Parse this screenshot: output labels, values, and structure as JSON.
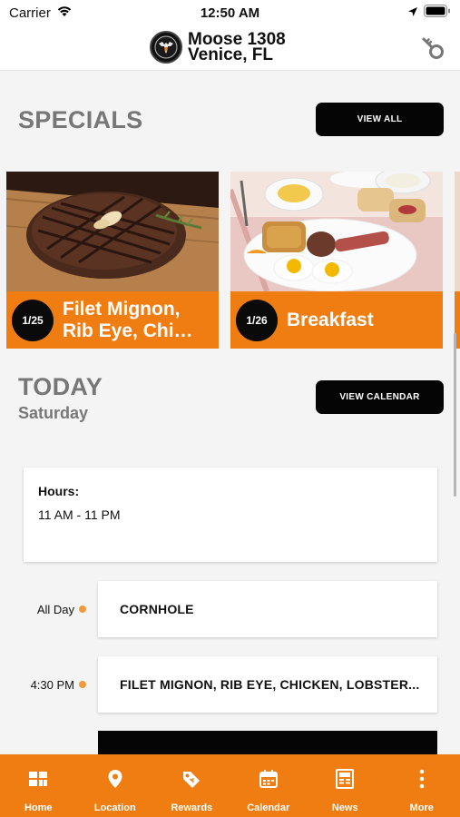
{
  "status_bar": {
    "carrier": "Carrier",
    "time": "12:50 AM"
  },
  "header": {
    "title_line1": "Moose 1308",
    "title_line2": "Venice, FL"
  },
  "specials": {
    "title": "SPECIALS",
    "view_all_label": "VIEW ALL",
    "items": [
      {
        "date": "1/25",
        "title": "Filet Mignon, Rib Eye, Chi…"
      },
      {
        "date": "1/26",
        "title": "Breakfast"
      }
    ]
  },
  "today": {
    "title": "TODAY",
    "day": "Saturday",
    "view_calendar_label": "VIEW CALENDAR",
    "hours_label": "Hours:",
    "hours_value": "11 AM - 11 PM",
    "events": [
      {
        "time": "All Day",
        "name": "CORNHOLE"
      },
      {
        "time": "4:30 PM",
        "name": "FILET MIGNON, RIB EYE, CHICKEN, LOBSTER..."
      }
    ]
  },
  "tabs": [
    {
      "label": "Home",
      "icon": "home-grid-icon"
    },
    {
      "label": "Location",
      "icon": "map-pin-icon"
    },
    {
      "label": "Rewards",
      "icon": "tag-icon"
    },
    {
      "label": "Calendar",
      "icon": "calendar-icon"
    },
    {
      "label": "News",
      "icon": "newspaper-icon"
    },
    {
      "label": "More",
      "icon": "more-dots-icon"
    }
  ],
  "colors": {
    "accent": "#ef7d12",
    "button": "#050505",
    "heading": "#777777",
    "event_dot": "#f09a3c"
  }
}
